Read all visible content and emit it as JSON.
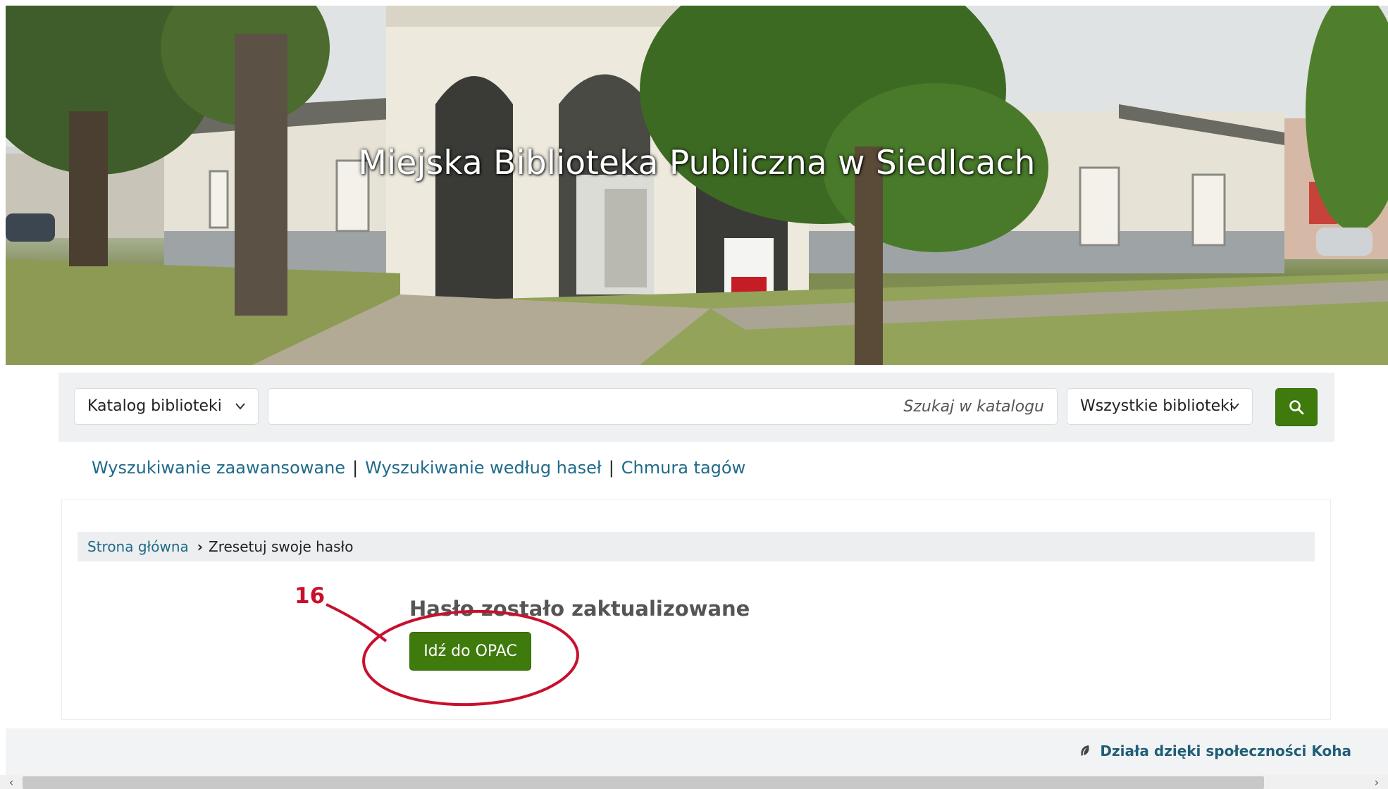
{
  "header": {
    "title": "Miejska Biblioteka Publiczna w Siedlcach"
  },
  "search": {
    "catalog_select": "Katalog biblioteki",
    "placeholder": "Szukaj w katalogu",
    "library_select": "Wszystkie biblioteki",
    "button_icon": "search-icon"
  },
  "links": {
    "advanced": "Wyszukiwanie zaawansowane",
    "separator": "|",
    "by_terms": "Wyszukiwanie według haseł",
    "tag_cloud": "Chmura tagów"
  },
  "breadcrumb": {
    "home": "Strona główna",
    "separator": "›",
    "current": "Zresetuj swoje hasło"
  },
  "main": {
    "heading": "Hasło zostało zaktualizowane",
    "opac_button": "Idź do OPAC"
  },
  "annotation": {
    "step_number": "16",
    "color": "#c8102e"
  },
  "footer": {
    "powered_by": "Działa dzięki społeczności Koha",
    "icon": "koha-leaf-icon"
  },
  "scrollbar": {
    "left_arrow": "‹",
    "right_arrow": "›"
  },
  "colors": {
    "primary_button": "#3f7a0c",
    "link": "#1f6a8a"
  }
}
